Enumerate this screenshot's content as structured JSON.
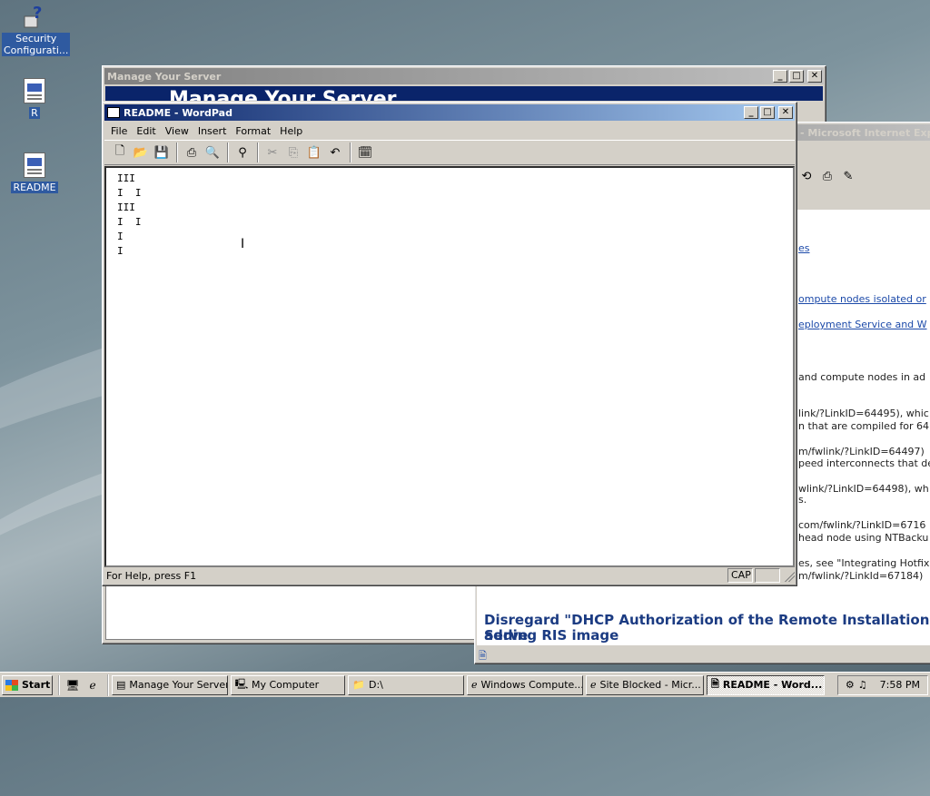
{
  "desktop": {
    "icons": [
      {
        "label": "Security Configurati...",
        "icon": "help-shortcut-icon"
      },
      {
        "label": "R",
        "icon": "document-icon"
      },
      {
        "label": "README",
        "icon": "document-icon"
      }
    ]
  },
  "manage_server": {
    "title": "Manage Your Server",
    "banner": "Manage Your Server"
  },
  "ie_window": {
    "title": "- Microsoft Internet Explorer",
    "lines": [
      {
        "text": "es",
        "link": true
      },
      {
        "text": "ompute nodes isolated or",
        "link": true
      },
      {
        "text": "eployment Service and W",
        "link": true
      },
      {
        "text": "and compute nodes in ad",
        "link": false
      },
      {
        "text": "link/?LinkID=64495), whic",
        "link": false
      },
      {
        "text": "n that are compiled for 64",
        "link": false
      },
      {
        "text": "m/fwlink/?LinkID=64497)",
        "link": false
      },
      {
        "text": "peed interconnects that de",
        "link": false
      },
      {
        "text": "wlink/?LinkID=64498), wh",
        "link": false
      },
      {
        "text": "s.",
        "link": false
      },
      {
        "text": "com/fwlink/?LinkID=6716",
        "link": false
      },
      {
        "text": "head node using NTBacku",
        "link": false
      },
      {
        "text": "es, see \"Integrating Hotfix",
        "link": false
      },
      {
        "text": "m/fwlink/?LinkId=67184)",
        "link": false
      }
    ],
    "heading_line1": "Disregard \"DHCP Authorization of the Remote Installation Serve",
    "heading_line2": "adding RIS image"
  },
  "wordpad": {
    "title": "README - WordPad",
    "menu": [
      "File",
      "Edit",
      "View",
      "Insert",
      "Format",
      "Help"
    ],
    "document_text": "III\nI  I\nIII\nI  I\nI\nI",
    "status": "For Help, press F1",
    "cap": "CAP"
  },
  "taskbar": {
    "start_label": "Start",
    "tasks": [
      {
        "label": "Manage Your Server",
        "icon": "server-icon",
        "active": false
      },
      {
        "label": "My Computer",
        "icon": "computer-icon",
        "active": false
      },
      {
        "label": "D:\\",
        "icon": "folder-icon",
        "active": false
      },
      {
        "label": "Windows Compute...",
        "icon": "ie-icon",
        "active": false
      },
      {
        "label": "Site Blocked - Micr...",
        "icon": "ie-icon",
        "active": false
      },
      {
        "label": "README - Word...",
        "icon": "wordpad-icon",
        "active": true
      }
    ],
    "clock": "7:58 PM"
  }
}
